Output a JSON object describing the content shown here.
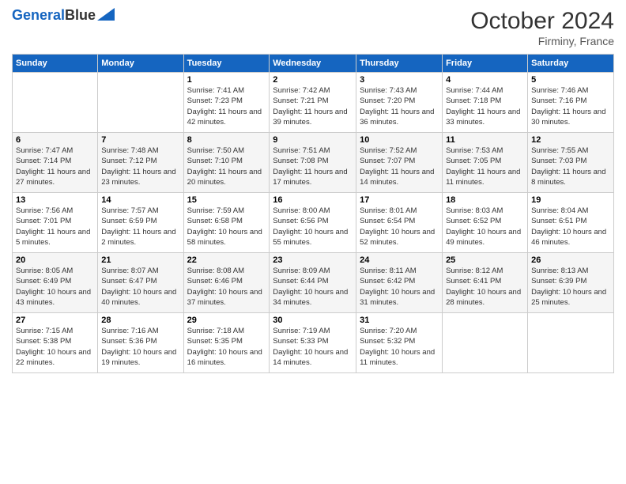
{
  "logo": {
    "line1": "General",
    "line2": "Blue"
  },
  "header": {
    "month": "October 2024",
    "location": "Firminy, France"
  },
  "days_of_week": [
    "Sunday",
    "Monday",
    "Tuesday",
    "Wednesday",
    "Thursday",
    "Friday",
    "Saturday"
  ],
  "weeks": [
    [
      {
        "day": "",
        "sunrise": "",
        "sunset": "",
        "daylight": ""
      },
      {
        "day": "",
        "sunrise": "",
        "sunset": "",
        "daylight": ""
      },
      {
        "day": "1",
        "sunrise": "Sunrise: 7:41 AM",
        "sunset": "Sunset: 7:23 PM",
        "daylight": "Daylight: 11 hours and 42 minutes."
      },
      {
        "day": "2",
        "sunrise": "Sunrise: 7:42 AM",
        "sunset": "Sunset: 7:21 PM",
        "daylight": "Daylight: 11 hours and 39 minutes."
      },
      {
        "day": "3",
        "sunrise": "Sunrise: 7:43 AM",
        "sunset": "Sunset: 7:20 PM",
        "daylight": "Daylight: 11 hours and 36 minutes."
      },
      {
        "day": "4",
        "sunrise": "Sunrise: 7:44 AM",
        "sunset": "Sunset: 7:18 PM",
        "daylight": "Daylight: 11 hours and 33 minutes."
      },
      {
        "day": "5",
        "sunrise": "Sunrise: 7:46 AM",
        "sunset": "Sunset: 7:16 PM",
        "daylight": "Daylight: 11 hours and 30 minutes."
      }
    ],
    [
      {
        "day": "6",
        "sunrise": "Sunrise: 7:47 AM",
        "sunset": "Sunset: 7:14 PM",
        "daylight": "Daylight: 11 hours and 27 minutes."
      },
      {
        "day": "7",
        "sunrise": "Sunrise: 7:48 AM",
        "sunset": "Sunset: 7:12 PM",
        "daylight": "Daylight: 11 hours and 23 minutes."
      },
      {
        "day": "8",
        "sunrise": "Sunrise: 7:50 AM",
        "sunset": "Sunset: 7:10 PM",
        "daylight": "Daylight: 11 hours and 20 minutes."
      },
      {
        "day": "9",
        "sunrise": "Sunrise: 7:51 AM",
        "sunset": "Sunset: 7:08 PM",
        "daylight": "Daylight: 11 hours and 17 minutes."
      },
      {
        "day": "10",
        "sunrise": "Sunrise: 7:52 AM",
        "sunset": "Sunset: 7:07 PM",
        "daylight": "Daylight: 11 hours and 14 minutes."
      },
      {
        "day": "11",
        "sunrise": "Sunrise: 7:53 AM",
        "sunset": "Sunset: 7:05 PM",
        "daylight": "Daylight: 11 hours and 11 minutes."
      },
      {
        "day": "12",
        "sunrise": "Sunrise: 7:55 AM",
        "sunset": "Sunset: 7:03 PM",
        "daylight": "Daylight: 11 hours and 8 minutes."
      }
    ],
    [
      {
        "day": "13",
        "sunrise": "Sunrise: 7:56 AM",
        "sunset": "Sunset: 7:01 PM",
        "daylight": "Daylight: 11 hours and 5 minutes."
      },
      {
        "day": "14",
        "sunrise": "Sunrise: 7:57 AM",
        "sunset": "Sunset: 6:59 PM",
        "daylight": "Daylight: 11 hours and 2 minutes."
      },
      {
        "day": "15",
        "sunrise": "Sunrise: 7:59 AM",
        "sunset": "Sunset: 6:58 PM",
        "daylight": "Daylight: 10 hours and 58 minutes."
      },
      {
        "day": "16",
        "sunrise": "Sunrise: 8:00 AM",
        "sunset": "Sunset: 6:56 PM",
        "daylight": "Daylight: 10 hours and 55 minutes."
      },
      {
        "day": "17",
        "sunrise": "Sunrise: 8:01 AM",
        "sunset": "Sunset: 6:54 PM",
        "daylight": "Daylight: 10 hours and 52 minutes."
      },
      {
        "day": "18",
        "sunrise": "Sunrise: 8:03 AM",
        "sunset": "Sunset: 6:52 PM",
        "daylight": "Daylight: 10 hours and 49 minutes."
      },
      {
        "day": "19",
        "sunrise": "Sunrise: 8:04 AM",
        "sunset": "Sunset: 6:51 PM",
        "daylight": "Daylight: 10 hours and 46 minutes."
      }
    ],
    [
      {
        "day": "20",
        "sunrise": "Sunrise: 8:05 AM",
        "sunset": "Sunset: 6:49 PM",
        "daylight": "Daylight: 10 hours and 43 minutes."
      },
      {
        "day": "21",
        "sunrise": "Sunrise: 8:07 AM",
        "sunset": "Sunset: 6:47 PM",
        "daylight": "Daylight: 10 hours and 40 minutes."
      },
      {
        "day": "22",
        "sunrise": "Sunrise: 8:08 AM",
        "sunset": "Sunset: 6:46 PM",
        "daylight": "Daylight: 10 hours and 37 minutes."
      },
      {
        "day": "23",
        "sunrise": "Sunrise: 8:09 AM",
        "sunset": "Sunset: 6:44 PM",
        "daylight": "Daylight: 10 hours and 34 minutes."
      },
      {
        "day": "24",
        "sunrise": "Sunrise: 8:11 AM",
        "sunset": "Sunset: 6:42 PM",
        "daylight": "Daylight: 10 hours and 31 minutes."
      },
      {
        "day": "25",
        "sunrise": "Sunrise: 8:12 AM",
        "sunset": "Sunset: 6:41 PM",
        "daylight": "Daylight: 10 hours and 28 minutes."
      },
      {
        "day": "26",
        "sunrise": "Sunrise: 8:13 AM",
        "sunset": "Sunset: 6:39 PM",
        "daylight": "Daylight: 10 hours and 25 minutes."
      }
    ],
    [
      {
        "day": "27",
        "sunrise": "Sunrise: 7:15 AM",
        "sunset": "Sunset: 5:38 PM",
        "daylight": "Daylight: 10 hours and 22 minutes."
      },
      {
        "day": "28",
        "sunrise": "Sunrise: 7:16 AM",
        "sunset": "Sunset: 5:36 PM",
        "daylight": "Daylight: 10 hours and 19 minutes."
      },
      {
        "day": "29",
        "sunrise": "Sunrise: 7:18 AM",
        "sunset": "Sunset: 5:35 PM",
        "daylight": "Daylight: 10 hours and 16 minutes."
      },
      {
        "day": "30",
        "sunrise": "Sunrise: 7:19 AM",
        "sunset": "Sunset: 5:33 PM",
        "daylight": "Daylight: 10 hours and 14 minutes."
      },
      {
        "day": "31",
        "sunrise": "Sunrise: 7:20 AM",
        "sunset": "Sunset: 5:32 PM",
        "daylight": "Daylight: 10 hours and 11 minutes."
      },
      {
        "day": "",
        "sunrise": "",
        "sunset": "",
        "daylight": ""
      },
      {
        "day": "",
        "sunrise": "",
        "sunset": "",
        "daylight": ""
      }
    ]
  ]
}
